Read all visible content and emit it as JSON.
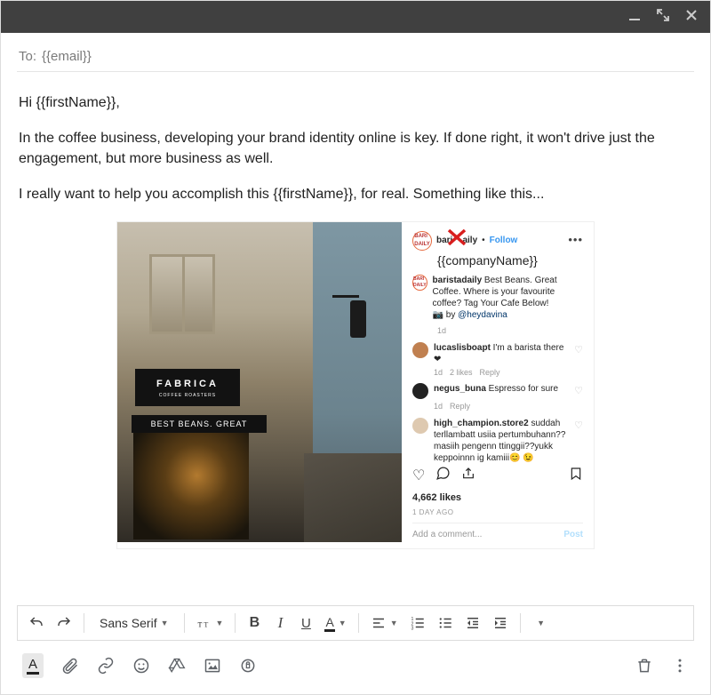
{
  "header": {
    "to_label": "To:",
    "to_value": "{{email}}"
  },
  "body": {
    "greeting": "Hi {{firstName}},",
    "p1": "In the coffee business, developing your brand identity online is key. If done right, it won't drive just the engagement, but more business as well.",
    "p2": "I really want to help you accomplish this {{firstName}}, for real. Something like this..."
  },
  "instagram": {
    "photo_brand": "FABRICA",
    "photo_subtitle": "COFFEE ROASTERS",
    "photo_tagline": "BEST BEANS. GREAT COFFEE.",
    "username_partial": "bari",
    "username_tail": "aily",
    "follow": "Follow",
    "company_placeholder": "{{companyName}}",
    "caption": {
      "user": "baristadaily",
      "text": " Best Beans. Great Coffee. Where is your favourite coffee? Tag Your Cafe Below!",
      "credit_prefix": "📷 by ",
      "credit_handle": "@heydavina"
    },
    "caption_time": "1d",
    "comments": [
      {
        "user": "lucaslisboapt",
        "text": " I'm a barista there ❤",
        "time": "1d",
        "likes": "2 likes",
        "reply": "Reply",
        "color": "#c08050"
      },
      {
        "user": "negus_buna",
        "text": " Espresso for sure",
        "time": "1d",
        "likes": "",
        "reply": "Reply",
        "color": "#222"
      },
      {
        "user": "high_champion.store2",
        "text": " suddah terllambatt usiia pertumbuhann?? masiih pengenn ttinggii??yukk keppoinnn ig kamiii😊 😉",
        "time": "",
        "likes": "",
        "reply": "",
        "color": "#dec9b0"
      }
    ],
    "likes": "4,662 likes",
    "when": "1 DAY AGO",
    "add_comment": "Add a comment...",
    "post": "Post"
  },
  "toolbar": {
    "font": "Sans Serif"
  }
}
